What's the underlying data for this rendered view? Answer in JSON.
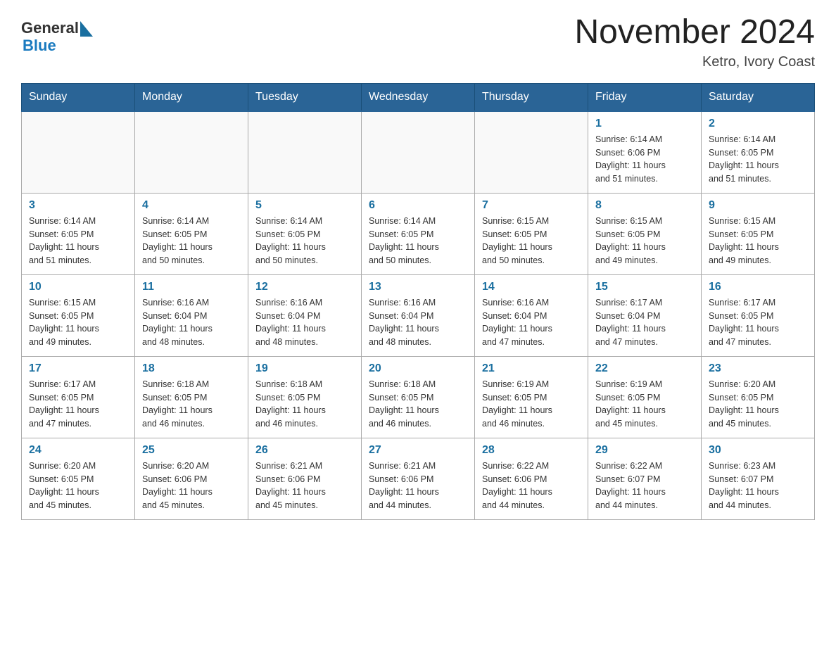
{
  "header": {
    "logo_line1": "General",
    "logo_line2": "Blue",
    "month_year": "November 2024",
    "location": "Ketro, Ivory Coast"
  },
  "days_of_week": [
    "Sunday",
    "Monday",
    "Tuesday",
    "Wednesday",
    "Thursday",
    "Friday",
    "Saturday"
  ],
  "weeks": [
    {
      "cells": [
        {
          "day": "",
          "info": ""
        },
        {
          "day": "",
          "info": ""
        },
        {
          "day": "",
          "info": ""
        },
        {
          "day": "",
          "info": ""
        },
        {
          "day": "",
          "info": ""
        },
        {
          "day": "1",
          "info": "Sunrise: 6:14 AM\nSunset: 6:06 PM\nDaylight: 11 hours\nand 51 minutes."
        },
        {
          "day": "2",
          "info": "Sunrise: 6:14 AM\nSunset: 6:05 PM\nDaylight: 11 hours\nand 51 minutes."
        }
      ]
    },
    {
      "cells": [
        {
          "day": "3",
          "info": "Sunrise: 6:14 AM\nSunset: 6:05 PM\nDaylight: 11 hours\nand 51 minutes."
        },
        {
          "day": "4",
          "info": "Sunrise: 6:14 AM\nSunset: 6:05 PM\nDaylight: 11 hours\nand 50 minutes."
        },
        {
          "day": "5",
          "info": "Sunrise: 6:14 AM\nSunset: 6:05 PM\nDaylight: 11 hours\nand 50 minutes."
        },
        {
          "day": "6",
          "info": "Sunrise: 6:14 AM\nSunset: 6:05 PM\nDaylight: 11 hours\nand 50 minutes."
        },
        {
          "day": "7",
          "info": "Sunrise: 6:15 AM\nSunset: 6:05 PM\nDaylight: 11 hours\nand 50 minutes."
        },
        {
          "day": "8",
          "info": "Sunrise: 6:15 AM\nSunset: 6:05 PM\nDaylight: 11 hours\nand 49 minutes."
        },
        {
          "day": "9",
          "info": "Sunrise: 6:15 AM\nSunset: 6:05 PM\nDaylight: 11 hours\nand 49 minutes."
        }
      ]
    },
    {
      "cells": [
        {
          "day": "10",
          "info": "Sunrise: 6:15 AM\nSunset: 6:05 PM\nDaylight: 11 hours\nand 49 minutes."
        },
        {
          "day": "11",
          "info": "Sunrise: 6:16 AM\nSunset: 6:04 PM\nDaylight: 11 hours\nand 48 minutes."
        },
        {
          "day": "12",
          "info": "Sunrise: 6:16 AM\nSunset: 6:04 PM\nDaylight: 11 hours\nand 48 minutes."
        },
        {
          "day": "13",
          "info": "Sunrise: 6:16 AM\nSunset: 6:04 PM\nDaylight: 11 hours\nand 48 minutes."
        },
        {
          "day": "14",
          "info": "Sunrise: 6:16 AM\nSunset: 6:04 PM\nDaylight: 11 hours\nand 47 minutes."
        },
        {
          "day": "15",
          "info": "Sunrise: 6:17 AM\nSunset: 6:04 PM\nDaylight: 11 hours\nand 47 minutes."
        },
        {
          "day": "16",
          "info": "Sunrise: 6:17 AM\nSunset: 6:05 PM\nDaylight: 11 hours\nand 47 minutes."
        }
      ]
    },
    {
      "cells": [
        {
          "day": "17",
          "info": "Sunrise: 6:17 AM\nSunset: 6:05 PM\nDaylight: 11 hours\nand 47 minutes."
        },
        {
          "day": "18",
          "info": "Sunrise: 6:18 AM\nSunset: 6:05 PM\nDaylight: 11 hours\nand 46 minutes."
        },
        {
          "day": "19",
          "info": "Sunrise: 6:18 AM\nSunset: 6:05 PM\nDaylight: 11 hours\nand 46 minutes."
        },
        {
          "day": "20",
          "info": "Sunrise: 6:18 AM\nSunset: 6:05 PM\nDaylight: 11 hours\nand 46 minutes."
        },
        {
          "day": "21",
          "info": "Sunrise: 6:19 AM\nSunset: 6:05 PM\nDaylight: 11 hours\nand 46 minutes."
        },
        {
          "day": "22",
          "info": "Sunrise: 6:19 AM\nSunset: 6:05 PM\nDaylight: 11 hours\nand 45 minutes."
        },
        {
          "day": "23",
          "info": "Sunrise: 6:20 AM\nSunset: 6:05 PM\nDaylight: 11 hours\nand 45 minutes."
        }
      ]
    },
    {
      "cells": [
        {
          "day": "24",
          "info": "Sunrise: 6:20 AM\nSunset: 6:05 PM\nDaylight: 11 hours\nand 45 minutes."
        },
        {
          "day": "25",
          "info": "Sunrise: 6:20 AM\nSunset: 6:06 PM\nDaylight: 11 hours\nand 45 minutes."
        },
        {
          "day": "26",
          "info": "Sunrise: 6:21 AM\nSunset: 6:06 PM\nDaylight: 11 hours\nand 45 minutes."
        },
        {
          "day": "27",
          "info": "Sunrise: 6:21 AM\nSunset: 6:06 PM\nDaylight: 11 hours\nand 44 minutes."
        },
        {
          "day": "28",
          "info": "Sunrise: 6:22 AM\nSunset: 6:06 PM\nDaylight: 11 hours\nand 44 minutes."
        },
        {
          "day": "29",
          "info": "Sunrise: 6:22 AM\nSunset: 6:07 PM\nDaylight: 11 hours\nand 44 minutes."
        },
        {
          "day": "30",
          "info": "Sunrise: 6:23 AM\nSunset: 6:07 PM\nDaylight: 11 hours\nand 44 minutes."
        }
      ]
    }
  ]
}
